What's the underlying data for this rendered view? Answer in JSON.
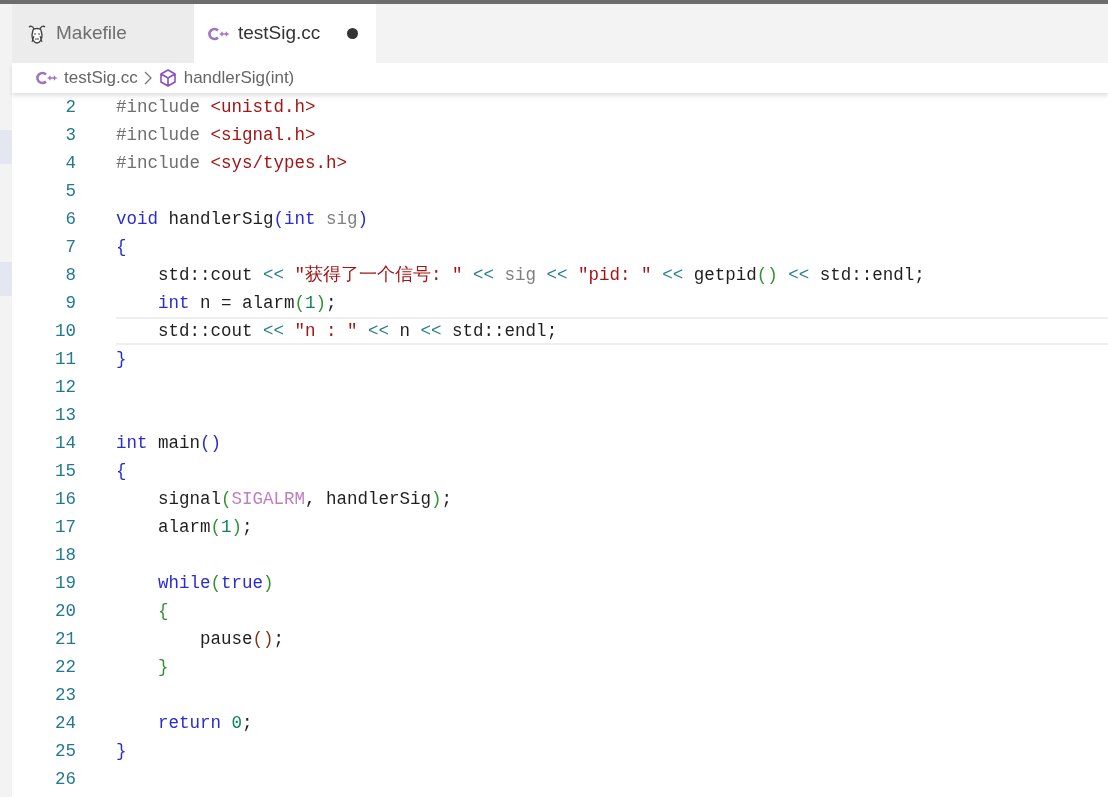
{
  "tabs": [
    {
      "label": "Makefile",
      "kind": "makefile",
      "selected": false,
      "modified": false
    },
    {
      "label": "testSig.cc",
      "kind": "cpp",
      "selected": true,
      "modified": true
    }
  ],
  "breadcrumb": [
    {
      "label": "testSig.cc",
      "kind": "cpp"
    },
    {
      "label": "handlerSig(int)",
      "kind": "symbol"
    }
  ],
  "lines": [
    {
      "number": "2",
      "current": false,
      "tokens": [
        {
          "text": "#include ",
          "kind": "preproc"
        },
        {
          "text": "<unistd.h>",
          "kind": "string"
        }
      ]
    },
    {
      "number": "3",
      "current": false,
      "tokens": [
        {
          "text": "#include ",
          "kind": "preproc"
        },
        {
          "text": "<signal.h>",
          "kind": "string"
        }
      ]
    },
    {
      "number": "4",
      "current": false,
      "tokens": [
        {
          "text": "#include ",
          "kind": "preproc"
        },
        {
          "text": "<sys/types.h>",
          "kind": "string"
        }
      ]
    },
    {
      "number": "5",
      "current": false
    },
    {
      "number": "6",
      "current": false,
      "tokens": [
        {
          "text": "void",
          "kind": "keyword"
        },
        {
          "text": " handlerSig",
          "kind": "plain"
        },
        {
          "text": "(",
          "kind": "bracket1"
        },
        {
          "text": "int",
          "kind": "keyword"
        },
        {
          "text": " sig",
          "kind": "param"
        },
        {
          "text": ")",
          "kind": "bracket1"
        }
      ]
    },
    {
      "number": "7",
      "current": false,
      "tokens": [
        {
          "text": "{",
          "kind": "bracket1"
        }
      ]
    },
    {
      "number": "8",
      "current": false,
      "tokens": [
        {
          "text": "    std::cout ",
          "kind": "plain"
        },
        {
          "text": "<< ",
          "kind": "operator"
        },
        {
          "text": "\"获得了一个信号: \" ",
          "kind": "string"
        },
        {
          "text": "<<",
          "kind": "operator"
        },
        {
          "text": " sig ",
          "kind": "param"
        },
        {
          "text": "<< ",
          "kind": "operator"
        },
        {
          "text": "\"pid: \" ",
          "kind": "string"
        },
        {
          "text": "<<",
          "kind": "operator"
        },
        {
          "text": " getpid",
          "kind": "plain"
        },
        {
          "text": "() ",
          "kind": "bracket2"
        },
        {
          "text": "<<",
          "kind": "operator"
        },
        {
          "text": " std::endl;",
          "kind": "plain"
        }
      ]
    },
    {
      "number": "9",
      "current": false,
      "tokens": [
        {
          "text": "    int",
          "kind": "keyword"
        },
        {
          "text": " n = alarm",
          "kind": "plain"
        },
        {
          "text": "(",
          "kind": "bracket2"
        },
        {
          "text": "1",
          "kind": "number"
        },
        {
          "text": ")",
          "kind": "bracket2"
        },
        {
          "text": ";",
          "kind": "plain"
        }
      ]
    },
    {
      "number": "10",
      "current": true,
      "tokens": [
        {
          "text": "    std::cout ",
          "kind": "plain"
        },
        {
          "text": "<< ",
          "kind": "operator"
        },
        {
          "text": "\"n : \" ",
          "kind": "string"
        },
        {
          "text": "<<",
          "kind": "operator"
        },
        {
          "text": " n ",
          "kind": "plain"
        },
        {
          "text": "<<",
          "kind": "operator"
        },
        {
          "text": " std::endl;",
          "kind": "plain"
        }
      ]
    },
    {
      "number": "11",
      "current": false,
      "tokens": [
        {
          "text": "}",
          "kind": "bracket1"
        }
      ]
    },
    {
      "number": "12",
      "current": false
    },
    {
      "number": "13",
      "current": false
    },
    {
      "number": "14",
      "current": false,
      "tokens": [
        {
          "text": "int",
          "kind": "keyword"
        },
        {
          "text": " main",
          "kind": "plain"
        },
        {
          "text": "()",
          "kind": "bracket1"
        }
      ]
    },
    {
      "number": "15",
      "current": false,
      "tokens": [
        {
          "text": "{",
          "kind": "bracket1"
        }
      ]
    },
    {
      "number": "16",
      "current": false,
      "tokens": [
        {
          "text": "    signal",
          "kind": "plain"
        },
        {
          "text": "(",
          "kind": "bracket2"
        },
        {
          "text": "SIGALRM",
          "kind": "macro"
        },
        {
          "text": ", handlerSig",
          "kind": "plain"
        },
        {
          "text": ")",
          "kind": "bracket2"
        },
        {
          "text": ";",
          "kind": "plain"
        }
      ]
    },
    {
      "number": "17",
      "current": false,
      "tokens": [
        {
          "text": "    alarm",
          "kind": "plain"
        },
        {
          "text": "(",
          "kind": "bracket2"
        },
        {
          "text": "1",
          "kind": "number"
        },
        {
          "text": ")",
          "kind": "bracket2"
        },
        {
          "text": ";",
          "kind": "plain"
        }
      ]
    },
    {
      "number": "18",
      "current": false
    },
    {
      "number": "19",
      "current": false,
      "tokens": [
        {
          "text": "    while",
          "kind": "keyword"
        },
        {
          "text": "(",
          "kind": "bracket2"
        },
        {
          "text": "true",
          "kind": "keyword"
        },
        {
          "text": ")",
          "kind": "bracket2"
        }
      ]
    },
    {
      "number": "20",
      "current": false,
      "tokens": [
        {
          "text": "    {",
          "kind": "bracket2"
        }
      ]
    },
    {
      "number": "21",
      "current": false,
      "tokens": [
        {
          "text": "        pause",
          "kind": "plain"
        },
        {
          "text": "()",
          "kind": "bracket3"
        },
        {
          "text": ";",
          "kind": "plain"
        }
      ]
    },
    {
      "number": "22",
      "current": false,
      "tokens": [
        {
          "text": "    }",
          "kind": "bracket2"
        }
      ]
    },
    {
      "number": "23",
      "current": false
    },
    {
      "number": "24",
      "current": false,
      "tokens": [
        {
          "text": "    return",
          "kind": "keyword"
        },
        {
          "text": " 0",
          "kind": "number"
        },
        {
          "text": ";",
          "kind": "plain"
        }
      ]
    },
    {
      "number": "25",
      "current": false,
      "tokens": [
        {
          "text": "}",
          "kind": "bracket1"
        }
      ]
    },
    {
      "number": "26",
      "current": false
    }
  ]
}
